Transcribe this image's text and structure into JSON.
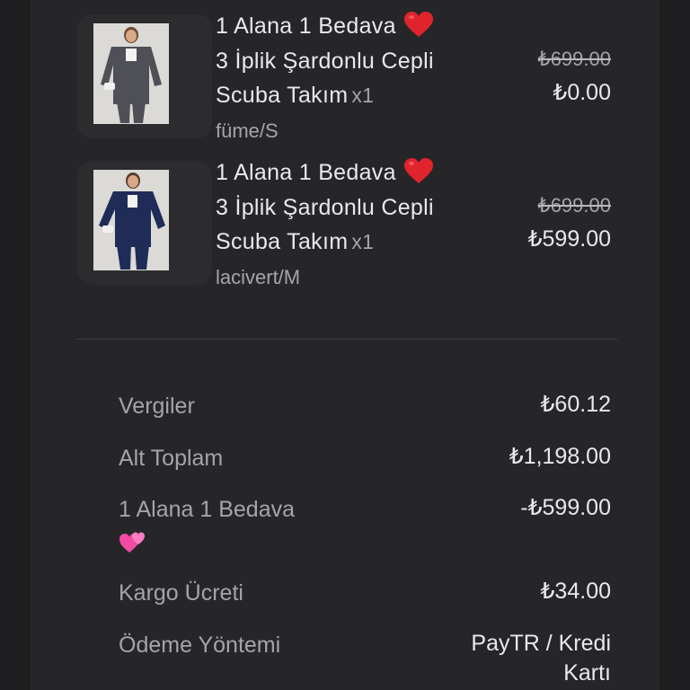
{
  "items": [
    {
      "title_lines": [
        "1 Alana 1 Bedava",
        "3 İplik Şardonlu Cepli",
        "Scuba Takım"
      ],
      "title_emoji": "heart-emoji",
      "quantity": "x1",
      "variant": "füme/S",
      "price_original": "₺699.00",
      "price_final": "₺0.00",
      "product_color": "#4e4f57"
    },
    {
      "title_lines": [
        "1 Alana 1 Bedava",
        "3 İplik Şardonlu Cepli",
        "Scuba Takım"
      ],
      "title_emoji": "heart-emoji",
      "quantity": "x1",
      "variant": "lacivert/M",
      "price_original": "₺699.00",
      "price_final": "₺599.00",
      "product_color": "#1f2c57"
    }
  ],
  "summary": {
    "taxes": {
      "label": "Vergiler",
      "value": "₺60.12"
    },
    "subtotal": {
      "label": "Alt Toplam",
      "value": "₺1,198.00"
    },
    "discount": {
      "label": "1 Alana 1 Bedava",
      "label_emoji": "two-hearts-emoji",
      "value": "-₺599.00"
    },
    "shipping": {
      "label": "Kargo Ücreti",
      "value": "₺34.00"
    },
    "payment": {
      "label": "Ödeme Yöntemi",
      "value_lines": [
        "PayTR / Kredi",
        "Kartı"
      ]
    }
  },
  "colors": {
    "background": "#1e1e20",
    "panel": "#262629",
    "text_primary": "#e9e9ec",
    "text_secondary": "#a4a4aa",
    "heart": "#e0242c",
    "two_hearts": "#f24ba4"
  }
}
